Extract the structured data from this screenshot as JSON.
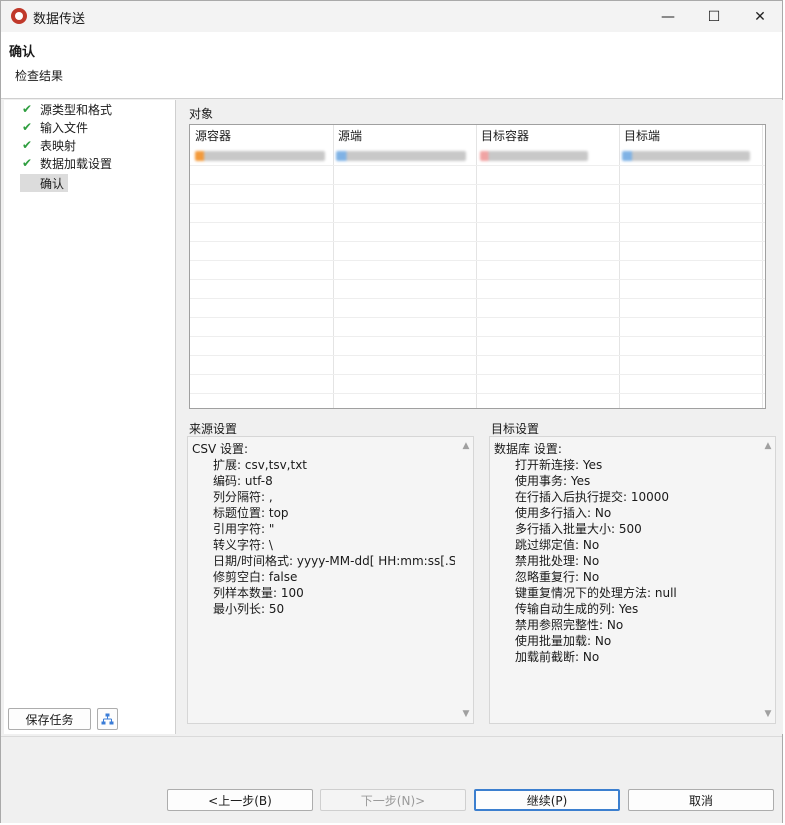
{
  "window": {
    "title": "数据传送",
    "minimize": "—",
    "maximize": "☐",
    "close": "✕"
  },
  "header": {
    "title": "确认",
    "subtitle": "检查结果"
  },
  "sidebar": {
    "items": [
      {
        "label": "源类型和格式",
        "done": true
      },
      {
        "label": "输入文件",
        "done": true
      },
      {
        "label": "表映射",
        "done": true
      },
      {
        "label": "数据加载设置",
        "done": true
      },
      {
        "label": "确认",
        "done": false,
        "selected": true
      }
    ],
    "save_task": "保存任务",
    "check_icon": "check-icon",
    "tree_icon": "tree-icon"
  },
  "objects": {
    "label": "对象",
    "columns": [
      "源容器",
      "源端",
      "目标容器",
      "目标端"
    ],
    "row_count_visible": 1
  },
  "source_settings": {
    "label": "来源设置",
    "heading": "CSV 设置:",
    "lines": [
      "扩展: csv,tsv,txt",
      "编码: utf-8",
      "列分隔符: ,",
      "标题位置: top",
      "引用字符: \"",
      "转义字符: \\",
      "日期/时间格式: yyyy-MM-dd[ HH:mm:ss[.S",
      "修剪空白: false",
      "列样本数量: 100",
      "最小列长: 50"
    ]
  },
  "target_settings": {
    "label": "目标设置",
    "heading": "数据库 设置:",
    "lines": [
      "打开新连接: Yes",
      "使用事务: Yes",
      "在行插入后执行提交: 10000",
      "使用多行插入: No",
      "多行插入批量大小: 500",
      "跳过绑定值: No",
      "禁用批处理: No",
      "忽略重复行: No",
      "键重复情况下的处理方法: null",
      "传输自动生成的列: Yes",
      "禁用参照完整性: No",
      "使用批量加载: No",
      "加载前截断: No"
    ]
  },
  "footer": {
    "back": "<上一步(B)",
    "next": "下一步(N)>",
    "continue": "继续(P)",
    "cancel": "取消"
  }
}
